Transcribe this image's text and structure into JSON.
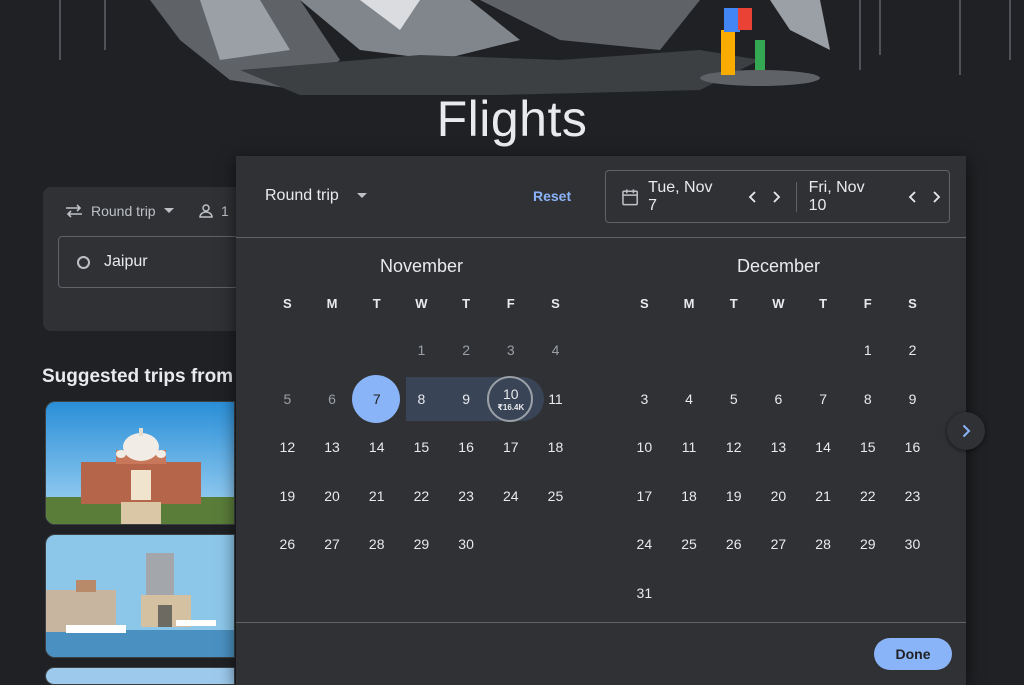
{
  "page": {
    "title": "Flights"
  },
  "search": {
    "trip_type": "Round trip",
    "passengers": "1",
    "origin": "Jaipur"
  },
  "suggested": {
    "title": "Suggested trips from J"
  },
  "dialog": {
    "trip_type": "Round trip",
    "reset_label": "Reset",
    "depart_date": "Tue, Nov 7",
    "return_date": "Fri, Nov 10",
    "done_label": "Done"
  },
  "weekdays": [
    "S",
    "M",
    "T",
    "W",
    "T",
    "F",
    "S"
  ],
  "months": [
    {
      "name": "November",
      "weeks": [
        [
          "",
          "",
          "",
          "1",
          "2",
          "3",
          "4"
        ],
        [
          "5",
          "6",
          "7",
          "8",
          "9",
          "10",
          "11"
        ],
        [
          "12",
          "13",
          "14",
          "15",
          "16",
          "17",
          "18"
        ],
        [
          "19",
          "20",
          "21",
          "22",
          "23",
          "24",
          "25"
        ],
        [
          "26",
          "27",
          "28",
          "29",
          "30",
          "",
          ""
        ]
      ]
    },
    {
      "name": "December",
      "weeks": [
        [
          "",
          "",
          "",
          "",
          "",
          "1",
          "2"
        ],
        [
          "3",
          "4",
          "5",
          "6",
          "7",
          "8",
          "9"
        ],
        [
          "10",
          "11",
          "12",
          "13",
          "14",
          "15",
          "16"
        ],
        [
          "17",
          "18",
          "19",
          "20",
          "21",
          "22",
          "23"
        ],
        [
          "24",
          "25",
          "26",
          "27",
          "28",
          "29",
          "30"
        ],
        [
          "31",
          "",
          "",
          "",
          "",
          "",
          ""
        ]
      ]
    }
  ],
  "selection": {
    "start_day": "7",
    "end_day": "10",
    "end_price": "₹16.4K",
    "past_days_before": "7"
  },
  "colors": {
    "accent": "#8ab4f8",
    "range": "#394457",
    "surface": "#303134",
    "background": "#202124"
  }
}
